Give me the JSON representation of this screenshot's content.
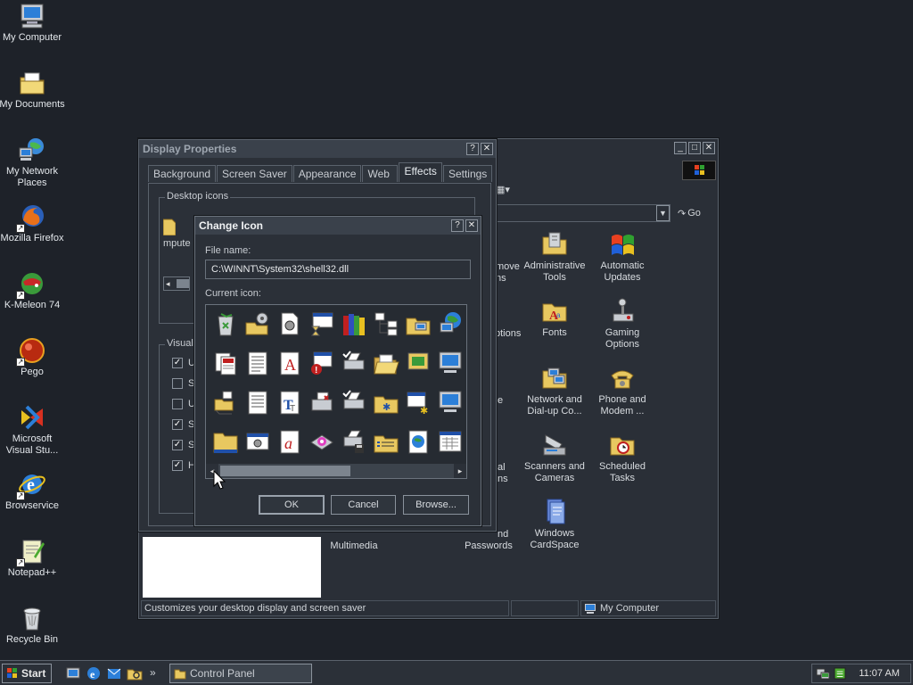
{
  "desktop": {
    "icons": [
      {
        "label": "My Computer",
        "icon": "my-computer-icon"
      },
      {
        "label": "My Documents",
        "icon": "my-documents-icon"
      },
      {
        "label": "My Network Places",
        "icon": "network-places-icon"
      },
      {
        "label": "Mozilla Firefox",
        "icon": "firefox-icon"
      },
      {
        "label": "K-Meleon 74",
        "icon": "k-meleon-icon"
      },
      {
        "label": "Pego",
        "icon": "pego-icon"
      },
      {
        "label": "Microsoft Visual Stu...",
        "icon": "visual-studio-icon"
      },
      {
        "label": "Browservice",
        "icon": "ie-icon"
      },
      {
        "label": "Notepad++",
        "icon": "notepad-plus-icon"
      },
      {
        "label": "Recycle Bin",
        "icon": "recycle-bin-icon"
      }
    ]
  },
  "control_panel": {
    "address_go": "Go",
    "items": [
      {
        "label": "Administrative Tools"
      },
      {
        "label": "Automatic Updates"
      },
      {
        "label": "Fonts"
      },
      {
        "label": "Gaming Options"
      },
      {
        "label": "Network and Dial-up Co..."
      },
      {
        "label": "Phone and Modem ..."
      },
      {
        "label": "Scanners and Cameras"
      },
      {
        "label": "Scheduled Tasks"
      },
      {
        "label": "Windows CardSpace"
      }
    ],
    "partial_items": {
      "remove": "move",
      "ms": "ns",
      "options": "ptions",
      "multimedia": "Multimedia",
      "passwords_top": "nd",
      "passwords": "Passwords",
      "al": "al",
      "ns2": "ns",
      "e": "e"
    },
    "status_text": "Customizes your desktop display and screen saver",
    "status_location": "My Computer"
  },
  "display_properties": {
    "title": "Display Properties",
    "tabs": [
      "Background",
      "Screen Saver",
      "Appearance",
      "Web",
      "Effects",
      "Settings"
    ],
    "active_tab": "Effects",
    "desktop_icons_legend": "Desktop icons",
    "partial_icon_label": "mpute",
    "visual_legend": "Visual",
    "checkbox_letters": [
      "U",
      "S",
      "U",
      "S",
      "S",
      "H"
    ]
  },
  "change_icon": {
    "title": "Change Icon",
    "file_name_label": "File name:",
    "file_name_value": "C:\\WINNT\\System32\\shell32.dll",
    "current_icon_label": "Current icon:",
    "ok": "OK",
    "cancel": "Cancel",
    "browse": "Browse..."
  },
  "taskbar": {
    "start": "Start",
    "task": "Control Panel",
    "clock": "11:07 AM"
  }
}
